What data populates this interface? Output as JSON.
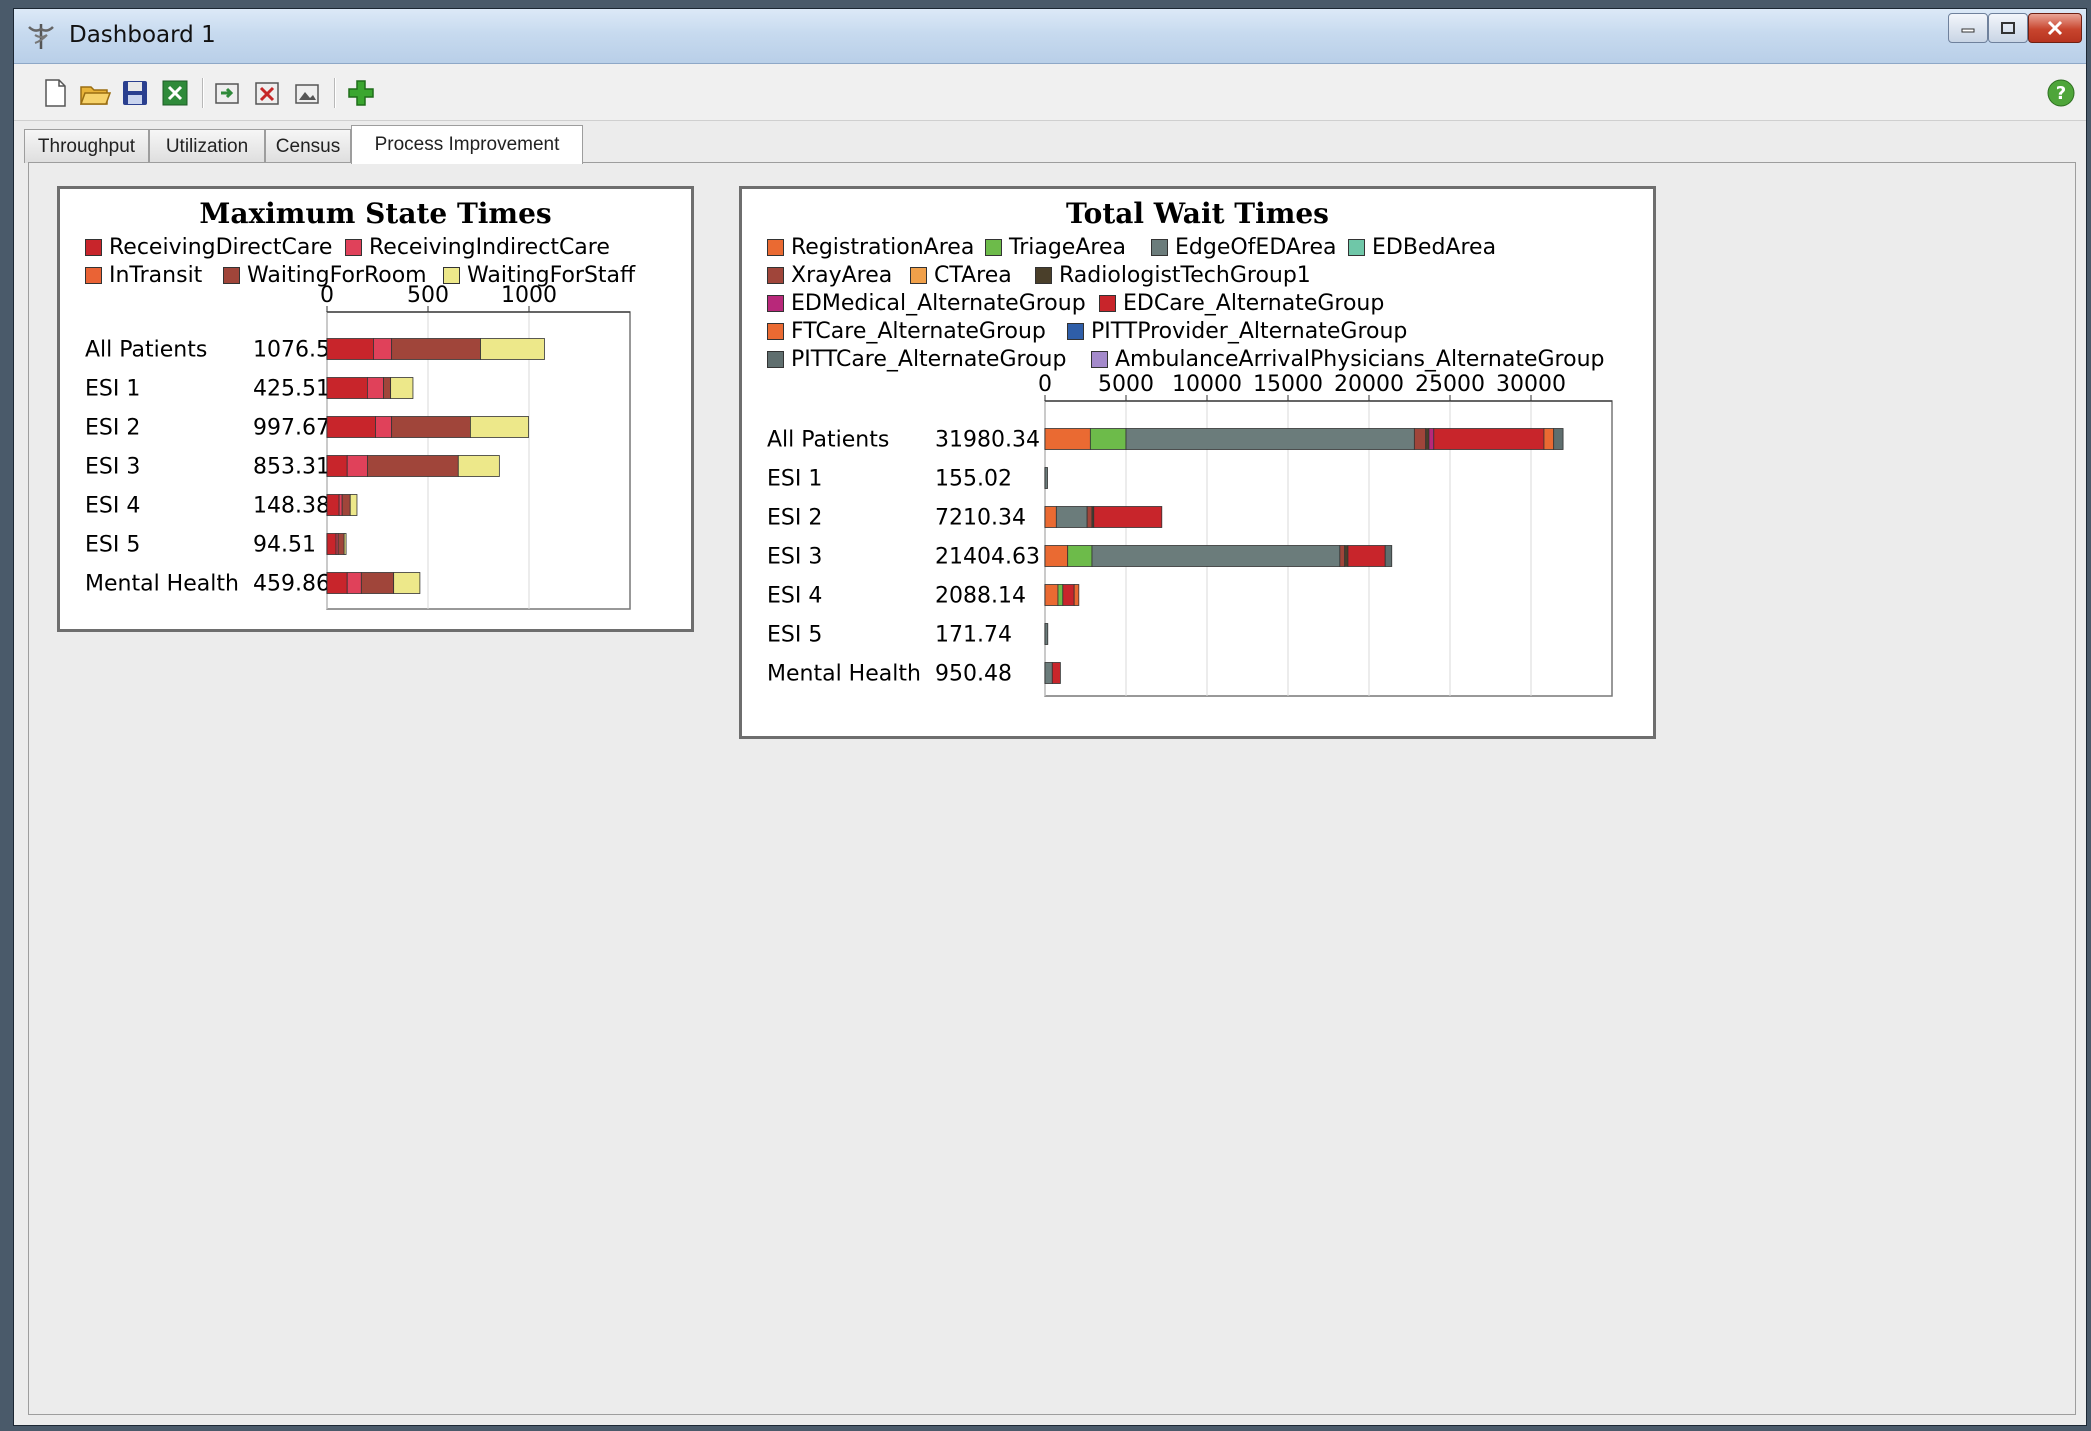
{
  "window": {
    "title": "Dashboard 1"
  },
  "toolbar": {
    "buttons": [
      "new-file-icon",
      "open-folder-icon",
      "save-icon",
      "excel-export-icon",
      "import-icon",
      "delete-icon",
      "image-export-icon",
      "add-icon"
    ],
    "help_icon": "help-icon"
  },
  "tabs": [
    {
      "label": "Throughput",
      "active": false
    },
    {
      "label": "Utilization",
      "active": false
    },
    {
      "label": "Census",
      "active": false
    },
    {
      "label": "Process Improvement",
      "active": true
    }
  ],
  "chart_data": [
    {
      "type": "bar",
      "orientation": "horizontal",
      "stacked": true,
      "title": "Maximum State Times",
      "categories": [
        "All Patients",
        "ESI 1",
        "ESI 2",
        "ESI 3",
        "ESI 4",
        "ESI 5",
        "Mental Health"
      ],
      "totals": [
        "1076.52",
        "425.51",
        "997.67",
        "853.31",
        "148.38",
        "94.51",
        "459.86"
      ],
      "xlim": [
        0,
        1500
      ],
      "xticks": [
        0,
        500,
        1000
      ],
      "legend_position": "top",
      "grid": true,
      "series": [
        {
          "name": "ReceivingDirectCare",
          "color": "#c8252b",
          "values": [
            230,
            200,
            240,
            100,
            60,
            45,
            100
          ]
        },
        {
          "name": "ReceivingIndirectCare",
          "color": "#e0415a",
          "values": [
            90,
            80,
            80,
            100,
            15,
            10,
            70
          ]
        },
        {
          "name": "InTransit",
          "color": "#ea6335",
          "values": [
            0,
            0,
            0,
            0,
            0,
            0,
            0
          ]
        },
        {
          "name": "WaitingForRoom",
          "color": "#a0453a",
          "values": [
            440,
            35,
            390,
            450,
            40,
            30,
            160
          ]
        },
        {
          "name": "WaitingForStaff",
          "color": "#ede88a",
          "values": [
            316.52,
            110.51,
            287.67,
            203.31,
            33.38,
            9.51,
            129.86
          ]
        }
      ]
    },
    {
      "type": "bar",
      "orientation": "horizontal",
      "stacked": true,
      "title": "Total Wait Times",
      "categories": [
        "All Patients",
        "ESI 1",
        "ESI 2",
        "ESI 3",
        "ESI 4",
        "ESI 5",
        "Mental Health"
      ],
      "totals": [
        "31980.34",
        "155.02",
        "7210.34",
        "21404.63",
        "2088.14",
        "171.74",
        "950.48"
      ],
      "xlim": [
        0,
        35000
      ],
      "xticks": [
        0,
        5000,
        10000,
        15000,
        20000,
        25000,
        30000
      ],
      "legend_position": "top",
      "grid": true,
      "series": [
        {
          "name": "RegistrationArea",
          "color": "#ea6a32",
          "values": [
            2800,
            0,
            700,
            1400,
            800,
            0,
            0
          ]
        },
        {
          "name": "TriageArea",
          "color": "#6dbb4a",
          "values": [
            2200,
            0,
            0,
            1500,
            300,
            0,
            0
          ]
        },
        {
          "name": "EdgeOfEDArea",
          "color": "#6b7c7b",
          "values": [
            17800,
            155.02,
            1900,
            15300,
            0,
            171.74,
            450
          ]
        },
        {
          "name": "EDBedArea",
          "color": "#6fc7a8",
          "values": [
            0,
            0,
            0,
            0,
            0,
            0,
            0
          ]
        },
        {
          "name": "XrayArea",
          "color": "#a0453a",
          "values": [
            700,
            0,
            300,
            300,
            0,
            0,
            0
          ]
        },
        {
          "name": "CTArea",
          "color": "#f0a04a",
          "values": [
            0,
            0,
            0,
            0,
            0,
            0,
            0
          ]
        },
        {
          "name": "RadiologistTechGroup1",
          "color": "#4a3f2a",
          "values": [
            200,
            0,
            110,
            200,
            0,
            0,
            0
          ]
        },
        {
          "name": "EDMedical_AlternateGroup",
          "color": "#b8287a",
          "values": [
            300,
            0,
            0,
            0,
            0,
            0,
            0
          ]
        },
        {
          "name": "EDCare_AlternateGroup",
          "color": "#c8252b",
          "values": [
            6800,
            0,
            4200,
            2300,
            700,
            0,
            500.48
          ]
        },
        {
          "name": "FTCare_AlternateGroup",
          "color": "#ea6a32",
          "values": [
            600,
            0,
            0,
            0,
            288.14,
            0,
            0
          ]
        },
        {
          "name": "PITTProvider_AlternateGroup",
          "color": "#2f5ea8",
          "values": [
            0,
            0,
            0,
            0,
            0,
            0,
            0
          ]
        },
        {
          "name": "PITTCare_AlternateGroup",
          "color": "#5f6e6e",
          "values": [
            580.34,
            0,
            0,
            404.63,
            0,
            0,
            0
          ]
        },
        {
          "name": "AmbulanceArrivalPhysicians_AlternateGroup",
          "color": "#a48acb",
          "values": [
            0,
            0,
            0,
            0,
            0,
            0,
            0
          ]
        }
      ]
    }
  ]
}
